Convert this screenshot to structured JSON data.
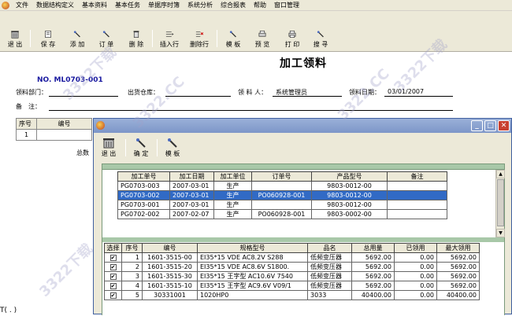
{
  "menu": [
    "文件",
    "数据结构定义",
    "基本资料",
    "基本任务",
    "单据序时簿",
    "系统分析",
    "综合报表",
    "帮助",
    "窗口管理"
  ],
  "toolbar": {
    "exit": "退 出",
    "save": "保 存",
    "add": "添 加",
    "order": "订 单",
    "delete": "删 除",
    "insert_row": "插入行",
    "delete_row": "删除行",
    "template": "模 板",
    "preview": "预 览",
    "print": "打 印",
    "search": "搜 寻"
  },
  "document": {
    "title": "加工领料",
    "number": "NO. ML0703-001",
    "dept_label": "领料部门：",
    "warehouse_label": "出货仓库：",
    "picker_label": "领 料 人：",
    "picker_value": "系统管理员",
    "date_label": "领料日期：",
    "date_value": "03/01/2007",
    "remark_label": "备　注：",
    "grid_headers": [
      "序号",
      "编号"
    ],
    "grid_rows": [
      [
        "1",
        ""
      ]
    ],
    "total_label": "总数",
    "bottom_text": "T( . )"
  },
  "dialog": {
    "toolbar": {
      "exit": "退 出",
      "confirm": "确 定",
      "template": "模 板"
    },
    "upper_headers": [
      "加工单号",
      "加工日期",
      "加工单位",
      "订单号",
      "产品型号",
      "备注"
    ],
    "upper_rows": [
      [
        "PG0703-003",
        "2007-03-01",
        "生产",
        "",
        "9803-0012-00",
        ""
      ],
      [
        "PG0703-002",
        "2007-03-01",
        "生产",
        "PO060928-001",
        "9803-0012-00",
        ""
      ],
      [
        "PG0703-001",
        "2007-03-01",
        "生产",
        "",
        "9803-0012-00",
        ""
      ],
      [
        "PG0702-002",
        "2007-02-07",
        "生产",
        "PO060928-001",
        "9803-0002-00",
        ""
      ]
    ],
    "upper_selected": 1,
    "lower_headers": [
      "选择",
      "序号",
      "编号",
      "规格型号",
      "品名",
      "总用量",
      "已领用",
      "最大领用"
    ],
    "lower_rows": [
      [
        "✔",
        "1",
        "1601-3515-00",
        "EI35*15 VDE AC8.2V S288",
        "低频变压器",
        "5692.00",
        "0.00",
        "5692.00"
      ],
      [
        "✔",
        "2",
        "1601-3515-20",
        "EI35*15 VDE AC8.6V S1800.",
        "低频变压器",
        "5692.00",
        "0.00",
        "5692.00"
      ],
      [
        "✔",
        "3",
        "1601-3515-30",
        "EI35*15 王字型 AC10.6V 7540",
        "低频变压器",
        "5692.00",
        "0.00",
        "5692.00"
      ],
      [
        "✔",
        "4",
        "1601-3515-10",
        "EI35*15 王字型 AC9.6V V09/1",
        "低频变压器",
        "5692.00",
        "0.00",
        "5692.00"
      ],
      [
        "✔",
        "5",
        "30331001",
        "1020HP0",
        "3033",
        "40400.00",
        "0.00",
        "40400.00"
      ]
    ]
  }
}
